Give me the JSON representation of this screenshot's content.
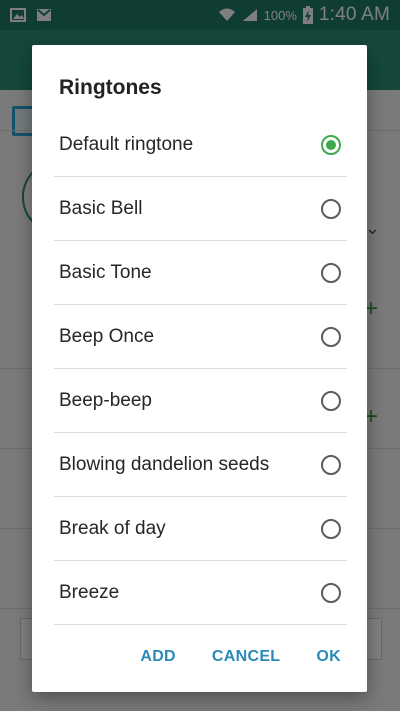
{
  "status_bar": {
    "battery_percent": "100%",
    "time": "1:40 AM",
    "icons": [
      "gallery-icon",
      "gmail-icon",
      "wifi-icon",
      "signal-icon",
      "battery-charging-icon"
    ]
  },
  "dialog": {
    "title": "Ringtones",
    "options": [
      {
        "label": "Default ringtone",
        "selected": true
      },
      {
        "label": "Basic Bell",
        "selected": false
      },
      {
        "label": "Basic Tone",
        "selected": false
      },
      {
        "label": "Beep Once",
        "selected": false
      },
      {
        "label": "Beep-beep",
        "selected": false
      },
      {
        "label": "Blowing dandelion seeds",
        "selected": false
      },
      {
        "label": "Break of day",
        "selected": false
      },
      {
        "label": "Breeze",
        "selected": false
      }
    ],
    "buttons": {
      "add": "ADD",
      "cancel": "CANCEL",
      "ok": "OK"
    }
  },
  "colors": {
    "accent_green": "#3fa94a",
    "button_blue": "#2a8ab8",
    "app_bar_teal": "#2a8f77"
  }
}
